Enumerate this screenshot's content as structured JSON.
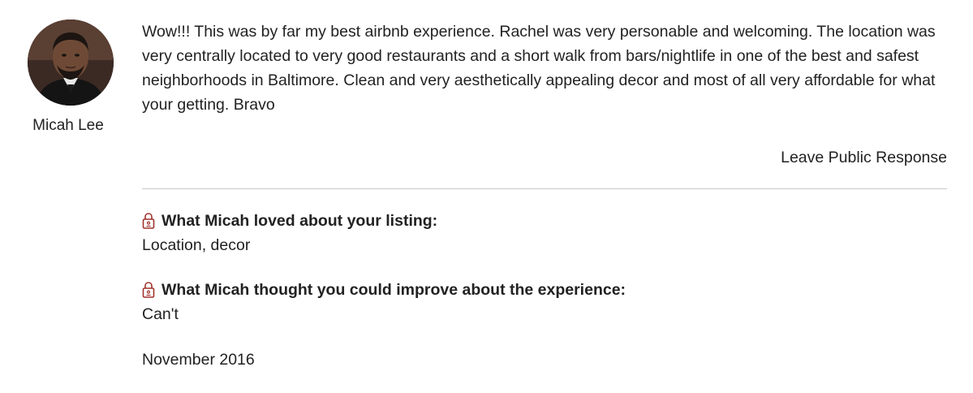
{
  "reviewer": {
    "name": "Micah Lee"
  },
  "review": {
    "text": "Wow!!! This was by far my best airbnb experience. Rachel was very personable and welcoming. The location was very centrally located to very good restaurants and a short walk from bars/nightlife in one of the best and safest neighborhoods in Baltimore. Clean and very aesthetically appealing decor and most of all very affordable for what your getting. Bravo",
    "date": "November 2016"
  },
  "actions": {
    "leave_response_label": "Leave Public Response"
  },
  "private_feedback": {
    "loved_heading": "What Micah loved about your listing:",
    "loved_answer": "Location, decor",
    "improve_heading": "What Micah thought you could improve about the experience:",
    "improve_answer": "Can't"
  },
  "icons": {
    "private": "lock-icon"
  },
  "colors": {
    "text": "#222222",
    "lock": "#a0322d",
    "divider": "#c8c8c8"
  }
}
